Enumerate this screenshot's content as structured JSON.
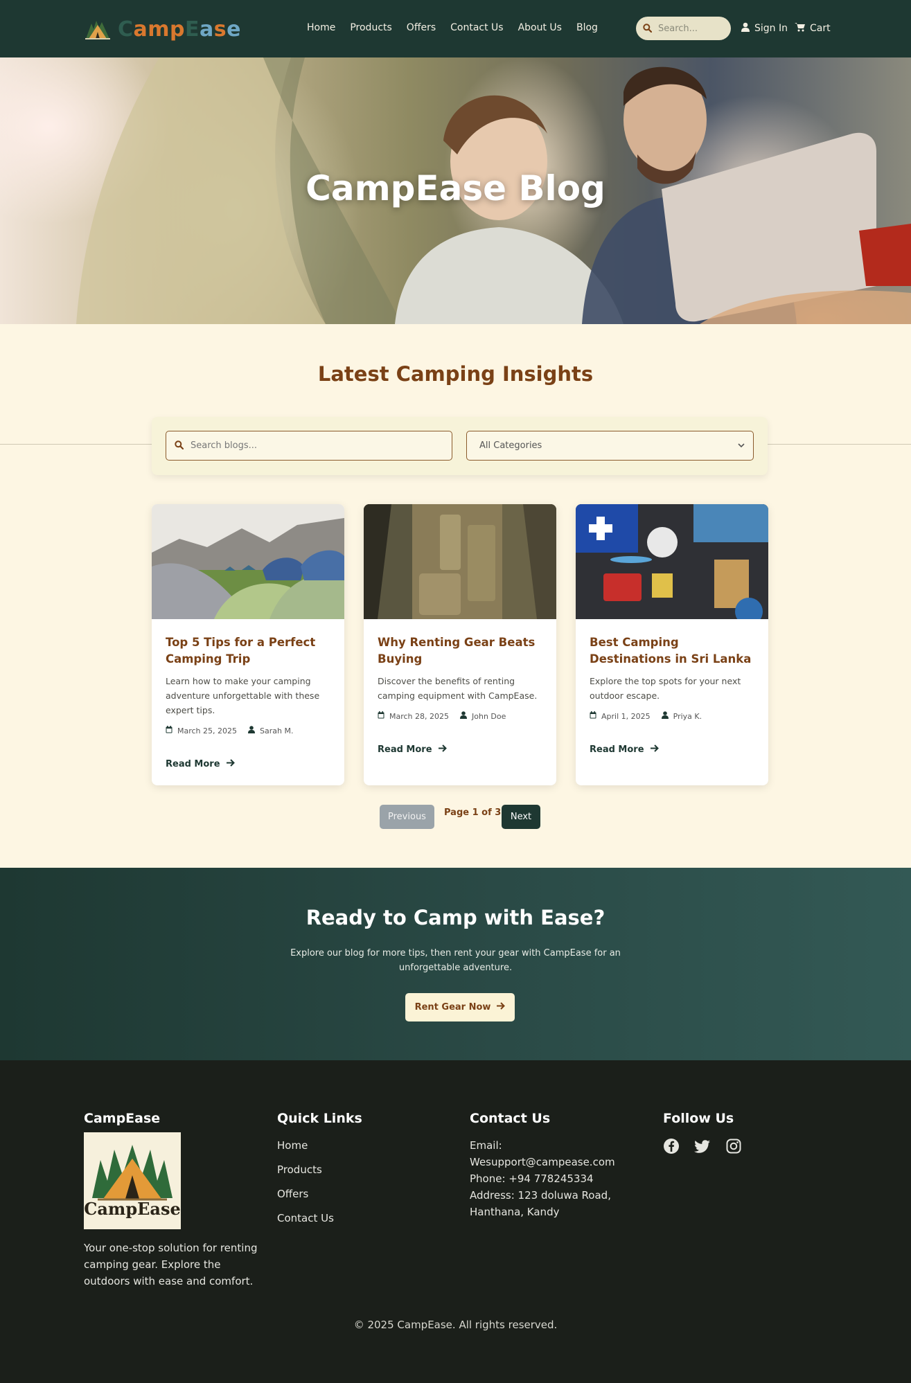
{
  "brand": {
    "name_parts": [
      "C",
      "amp",
      "E",
      "a",
      "s",
      "e"
    ],
    "colors": {
      "nav_bg": "#1e3832",
      "accent_brown": "#7a4116",
      "cream": "#fdf6e3",
      "footer_bg": "#1b1f1a"
    }
  },
  "nav": {
    "links": [
      "Home",
      "Products",
      "Offers",
      "Contact Us",
      "About Us",
      "Blog"
    ],
    "search_placeholder": "Search...",
    "signin_label": "Sign In",
    "cart_label": "Cart"
  },
  "hero": {
    "title": "CampEase Blog"
  },
  "main": {
    "section_title": "Latest Camping Insights",
    "filter": {
      "search_placeholder": "Search blogs...",
      "category_selected": "All Categories"
    },
    "posts": [
      {
        "title": "Top 5 Tips for a Perfect Camping Trip",
        "excerpt": "Learn how to make your camping adventure unforgettable with these expert tips.",
        "date": "March 25, 2025",
        "author": "Sarah M.",
        "read_more": "Read More",
        "image": "tents-campsite"
      },
      {
        "title": "Why Renting Gear Beats Buying",
        "excerpt": "Discover the benefits of renting camping equipment with CampEase.",
        "date": "March 28, 2025",
        "author": "John Doe",
        "read_more": "Read More",
        "image": "tactical-backpack"
      },
      {
        "title": "Best Camping Destinations in Sri Lanka",
        "excerpt": "Explore the top spots for your next outdoor escape.",
        "date": "April 1, 2025",
        "author": "Priya K.",
        "read_more": "Read More",
        "image": "first-aid-kit"
      }
    ],
    "pagination": {
      "prev_label": "Previous",
      "page_label": "Page 1 of 3",
      "next_label": "Next"
    }
  },
  "cta": {
    "title": "Ready to Camp with Ease?",
    "text": "Explore our blog for more tips, then rent your gear with CampEase for an unforgettable adventure.",
    "button_label": "Rent Gear Now"
  },
  "footer": {
    "brand_heading": "CampEase",
    "logo_text": "CampEase",
    "about": "Your one-stop solution for renting camping gear. Explore the outdoors with ease and comfort.",
    "quick_links_heading": "Quick Links",
    "quick_links": [
      "Home",
      "Products",
      "Offers",
      "Contact Us"
    ],
    "contact_heading": "Contact Us",
    "email": "Email: Wesupport@campease.com",
    "phone": "Phone: +94 778245334",
    "address": "Address: 123 doluwa Road, Hanthana, Kandy",
    "follow_heading": "Follow Us",
    "social_icons": [
      "facebook-icon",
      "twitter-icon",
      "instagram-icon"
    ],
    "copyright": "© 2025 CampEase. All rights reserved."
  }
}
